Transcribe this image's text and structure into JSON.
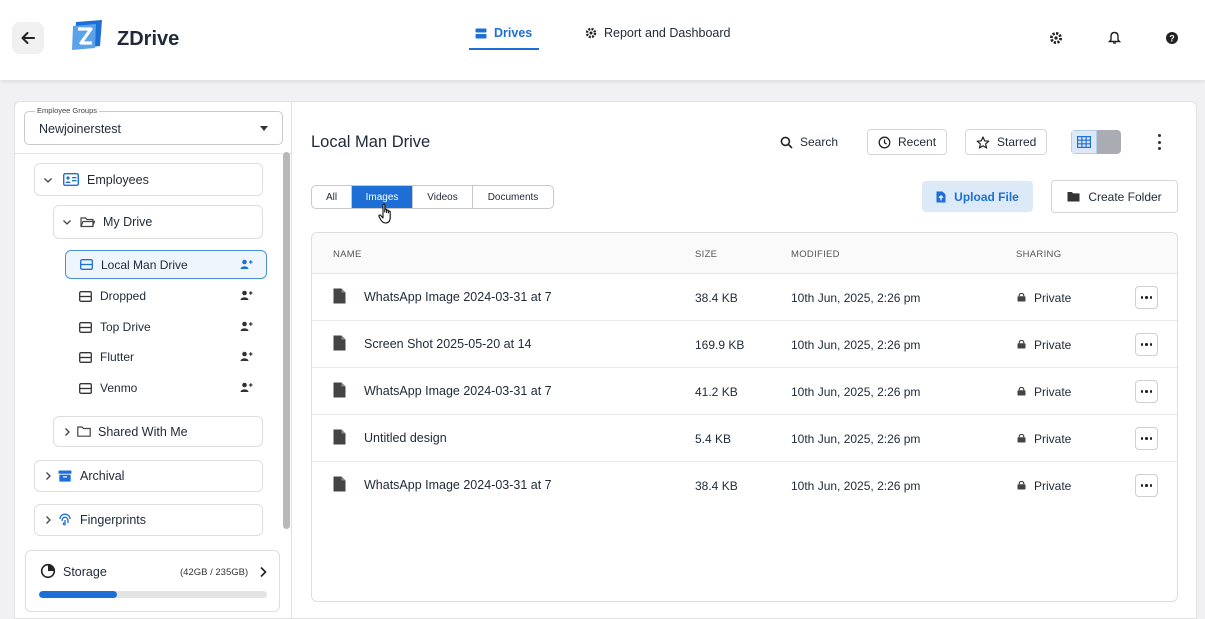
{
  "header": {
    "app_title": "ZDrive",
    "tabs": [
      {
        "label": "Drives",
        "icon": "drive-icon",
        "active": true
      },
      {
        "label": "Report and Dashboard",
        "icon": "gear-icon",
        "active": false
      }
    ],
    "icons": [
      "settings-icon",
      "bell-icon",
      "help-icon"
    ],
    "accent_color": "#1d6fd6"
  },
  "sidebar": {
    "group_select": {
      "legend": "Employee Groups",
      "value": "Newjoinerstest"
    },
    "employees": {
      "label": "Employees"
    },
    "my_drive": {
      "label": "My Drive"
    },
    "drives": [
      {
        "label": "Local Man Drive",
        "active": true
      },
      {
        "label": "Dropped",
        "active": false
      },
      {
        "label": "Top Drive",
        "active": false
      },
      {
        "label": "Flutter",
        "active": false
      },
      {
        "label": "Venmo",
        "active": false
      }
    ],
    "shared_with_me": {
      "label": "Shared With Me"
    },
    "archival": {
      "label": "Archival"
    },
    "fingerprints": {
      "label": "Fingerprints"
    },
    "storage": {
      "label": "Storage",
      "amount": "(42GB / 235GB)",
      "used_fraction": 0.34
    }
  },
  "main": {
    "title": "Local Man Drive",
    "toolbar": {
      "search": "Search",
      "recent": "Recent",
      "starred": "Starred"
    },
    "filters": [
      {
        "label": "All",
        "active": false
      },
      {
        "label": "Images",
        "active": true
      },
      {
        "label": "Videos",
        "active": false
      },
      {
        "label": "Documents",
        "active": false
      }
    ],
    "upload_label": "Upload File",
    "create_folder_label": "Create Folder",
    "table": {
      "columns": [
        "NAME",
        "SIZE",
        "MODIFIED",
        "SHARING"
      ],
      "rows": [
        {
          "name": "WhatsApp Image 2024-03-31 at 7",
          "size": "38.4 KB",
          "modified": "10th Jun, 2025, 2:26 pm",
          "sharing": "Private"
        },
        {
          "name": "Screen Shot 2025-05-20 at 14",
          "size": "169.9 KB",
          "modified": "10th Jun, 2025, 2:26 pm",
          "sharing": "Private"
        },
        {
          "name": "WhatsApp Image 2024-03-31 at 7",
          "size": "41.2 KB",
          "modified": "10th Jun, 2025, 2:26 pm",
          "sharing": "Private"
        },
        {
          "name": "Untitled design",
          "size": "5.4 KB",
          "modified": "10th Jun, 2025, 2:26 pm",
          "sharing": "Private"
        },
        {
          "name": "WhatsApp Image 2024-03-31 at 7",
          "size": "38.4 KB",
          "modified": "10th Jun, 2025, 2:26 pm",
          "sharing": "Private"
        }
      ]
    }
  }
}
